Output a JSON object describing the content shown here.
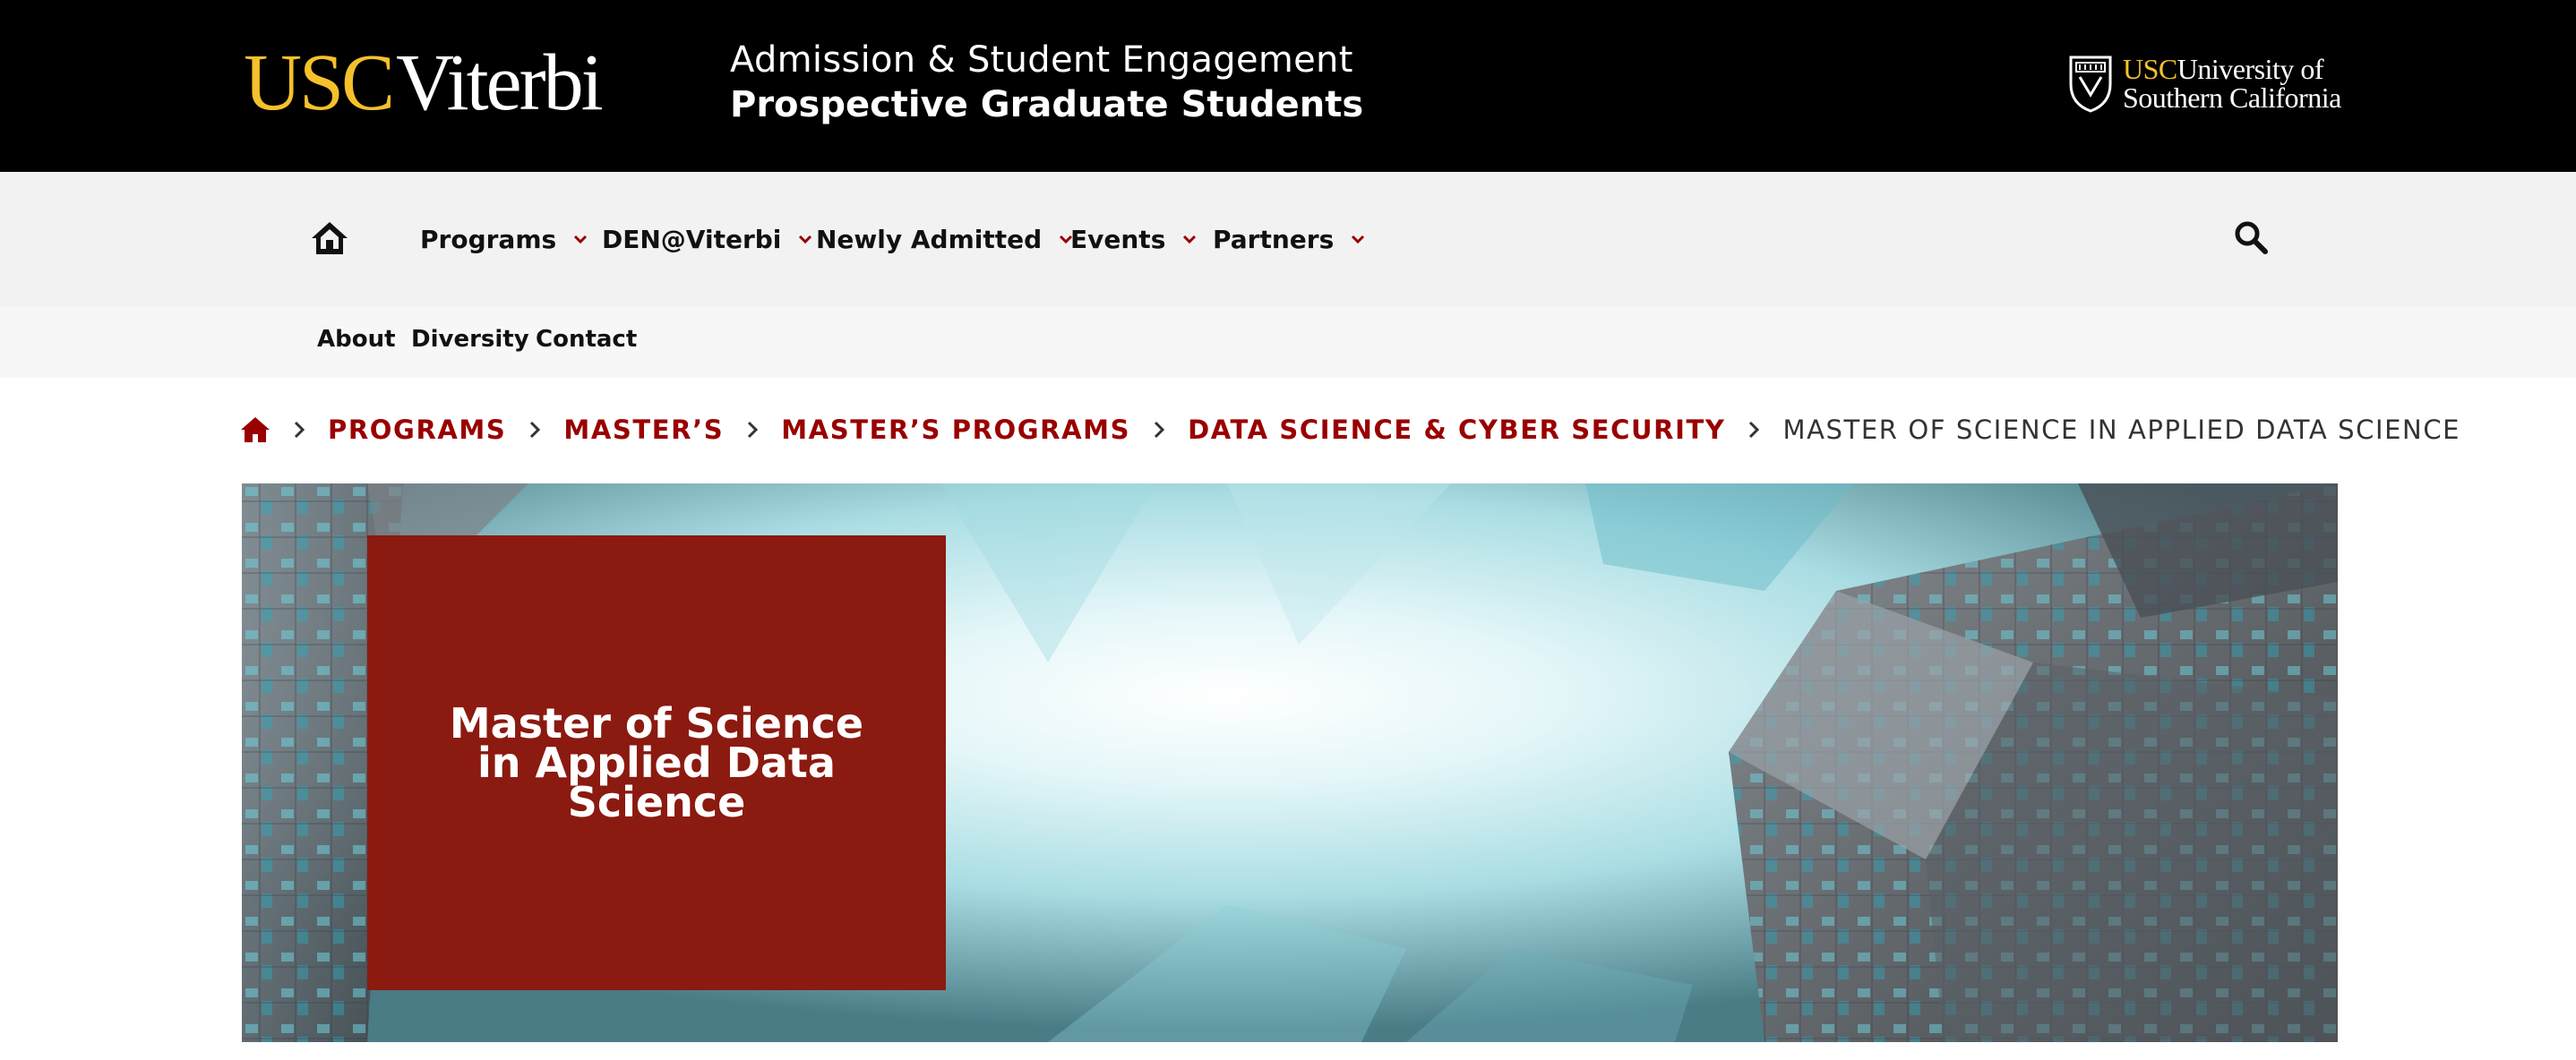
{
  "header": {
    "logo": {
      "usc": "USC",
      "viterbi": "Viterbi"
    },
    "title_line1": "Admission & Student Engagement",
    "title_line2": "Prospective Graduate Students",
    "university_logo": {
      "usc": "USC",
      "line1": "University of",
      "line2": "Southern California"
    }
  },
  "nav": {
    "home_icon": "home-icon",
    "items": [
      {
        "label": "Programs"
      },
      {
        "label": "DEN@Viterbi"
      },
      {
        "label": "Newly Admitted"
      },
      {
        "label": "Events"
      },
      {
        "label": "Partners"
      }
    ],
    "search_icon": "search-icon"
  },
  "subnav": {
    "items": [
      {
        "label": "About"
      },
      {
        "label": "Diversity"
      },
      {
        "label": "Contact"
      }
    ]
  },
  "breadcrumb": {
    "links": [
      {
        "label": "PROGRAMS"
      },
      {
        "label": "MASTER’S"
      },
      {
        "label": "MASTER’S PROGRAMS"
      },
      {
        "label": "DATA SCIENCE & CYBER SECURITY"
      }
    ],
    "current": "MASTER OF SCIENCE IN APPLIED DATA SCIENCE"
  },
  "hero": {
    "title": "Master of Science in Applied Data Science",
    "box_color": "#8b1a10"
  },
  "colors": {
    "header_bg": "#000000",
    "gold": "#f4c12b",
    "cardinal": "#990000",
    "nav_bg": "#f2f2f2"
  }
}
